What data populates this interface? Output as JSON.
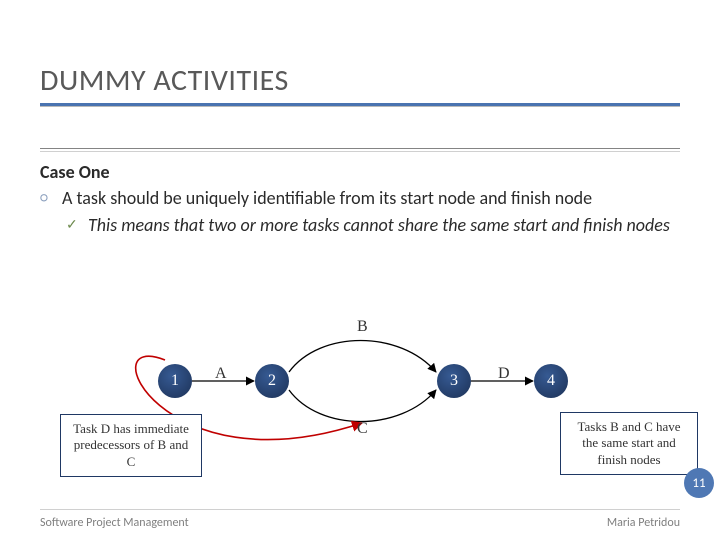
{
  "title": "DUMMY ACTIVITIES",
  "case_header": "Case One",
  "bullet1": "A task should be uniquely identifiable from its start node and finish node",
  "bullet2": "This means that two or more tasks cannot share the same start and finish nodes",
  "nodes": {
    "n1": "1",
    "n2": "2",
    "n3": "3",
    "n4": "4"
  },
  "edges": {
    "A": "A",
    "B": "B",
    "C": "C",
    "D": "D"
  },
  "callout_left": "Task D has immediate predecessors of B and C",
  "callout_right": "Tasks B and C have the same start and finish nodes",
  "page_number": "11",
  "footer_left": "Software Project Management",
  "footer_right": "Maria Petridou"
}
